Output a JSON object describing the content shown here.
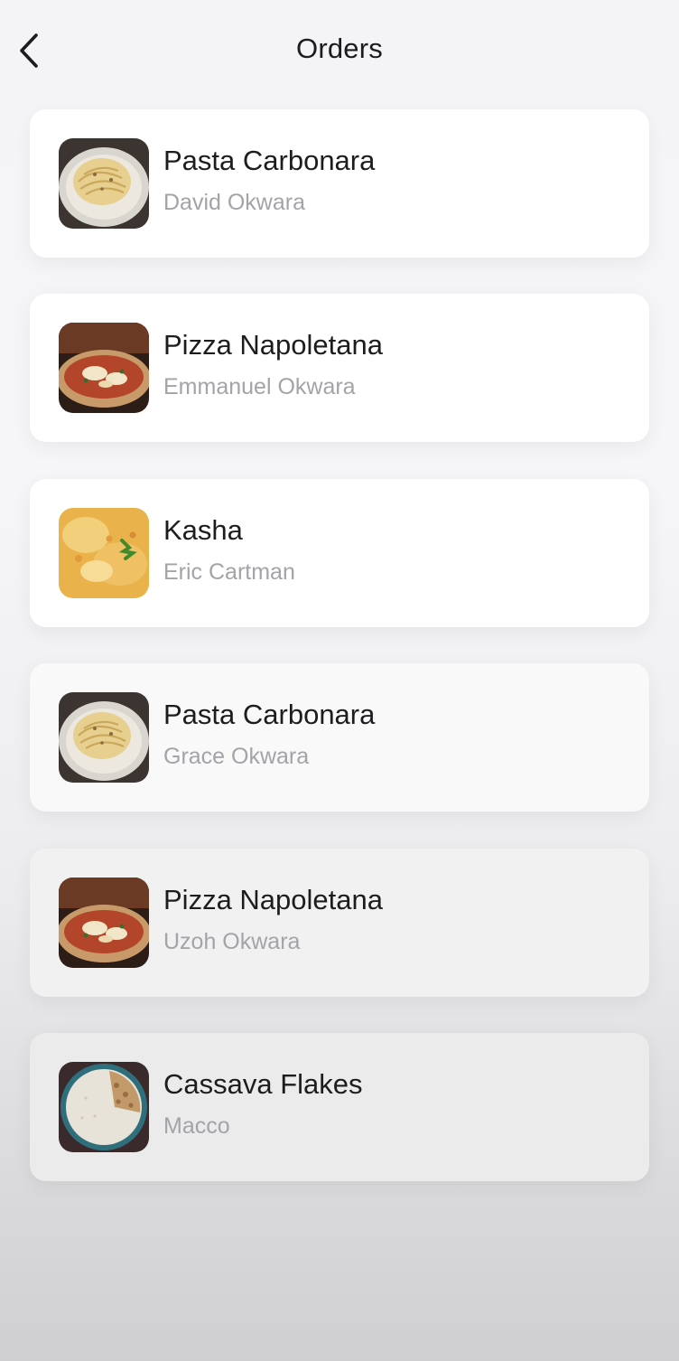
{
  "header": {
    "title": "Orders",
    "back_icon": "chevron-left-icon"
  },
  "orders": [
    {
      "dish": "Pasta Carbonara",
      "customer": "David Okwara",
      "image": "pasta-carbonara-photo"
    },
    {
      "dish": "Pizza Napoletana",
      "customer": "Emmanuel Okwara",
      "image": "pizza-napoletana-photo"
    },
    {
      "dish": "Kasha",
      "customer": "Eric Cartman",
      "image": "kasha-photo"
    },
    {
      "dish": "Pasta Carbonara",
      "customer": "Grace Okwara",
      "image": "pasta-carbonara-photo"
    },
    {
      "dish": "Pizza Napoletana",
      "customer": "Uzoh Okwara",
      "image": "pizza-napoletana-photo"
    },
    {
      "dish": "Cassava Flakes",
      "customer": "Macco",
      "image": "cassava-flakes-photo"
    }
  ]
}
